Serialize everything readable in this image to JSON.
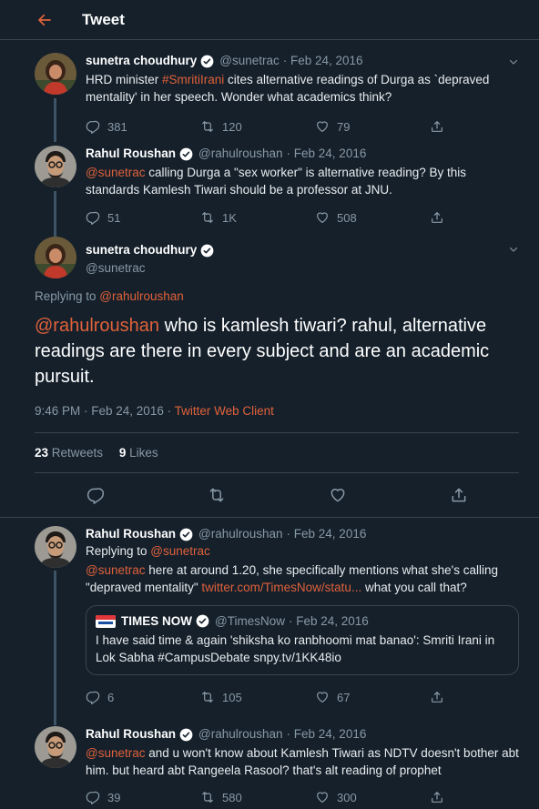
{
  "header": {
    "title": "Tweet"
  },
  "tweets": [
    {
      "name": "sunetra choudhury",
      "handle": "@sunetrac",
      "date": "· Feb 24, 2016",
      "text_parts": [
        "HRD minister ",
        "#SmritiIrani",
        " cites alternative readings of Durga as `depraved mentality' in her speech. Wonder what academics think?"
      ],
      "replies": "381",
      "retweets": "120",
      "likes": "79"
    },
    {
      "name": "Rahul Roushan",
      "handle": "@rahulroushan",
      "date": "· Feb 24, 2016",
      "text_parts": [
        "@sunetrac",
        " calling Durga a \"sex worker\" is alternative reading? By this standards Kamlesh Tiwari should be a professor at JNU."
      ],
      "replies": "51",
      "retweets": "1K",
      "likes": "508"
    }
  ],
  "main": {
    "name": "sunetra choudhury",
    "handle": "@sunetrac",
    "replying_label": "Replying to ",
    "replying_handle": "@rahulroushan",
    "text_mention": "@rahulroushan",
    "text_body": " who is kamlesh tiwari? rahul, alternative readings are there in every subject and are an academic pursuit.",
    "time": "9:46 PM · Feb 24, 2016 · ",
    "client": "Twitter Web Client",
    "retweets_count": "23",
    "retweets_label": " Retweets",
    "likes_count": "9",
    "likes_label": " Likes"
  },
  "replies": [
    {
      "name": "Rahul Roushan",
      "handle": "@rahulroushan",
      "date": "· Feb 24, 2016",
      "replying_label": "Replying to ",
      "replying_handle": "@sunetrac",
      "mention": "@sunetrac",
      "text1": " here at around 1.20, she specifically mentions what she's calling \"depraved mentality\" ",
      "link": "twitter.com/TimesNow/statu...",
      "text2": " what you call that?",
      "quote": {
        "name": "TIMES NOW",
        "handle": "@TimesNow",
        "date": "· Feb 24, 2016",
        "text": "I have said time & again 'shiksha ko ranbhoomi mat banao': Smriti Irani in Lok Sabha #CampusDebate  snpy.tv/1KK48io"
      },
      "replies": "6",
      "retweets": "105",
      "likes": "67"
    },
    {
      "name": "Rahul Roushan",
      "handle": "@rahulroushan",
      "date": "· Feb 24, 2016",
      "mention": "@sunetrac",
      "text1": " and u won't know about Kamlesh Tiwari as NDTV doesn't bother abt him. but heard abt Rangeela Rasool? that's alt reading of prophet",
      "replies": "39",
      "retweets": "580",
      "likes": "300"
    }
  ],
  "colors": {
    "background": "#15202b",
    "accent": "#e0613a",
    "muted": "#8899a6",
    "border": "#38444d"
  }
}
